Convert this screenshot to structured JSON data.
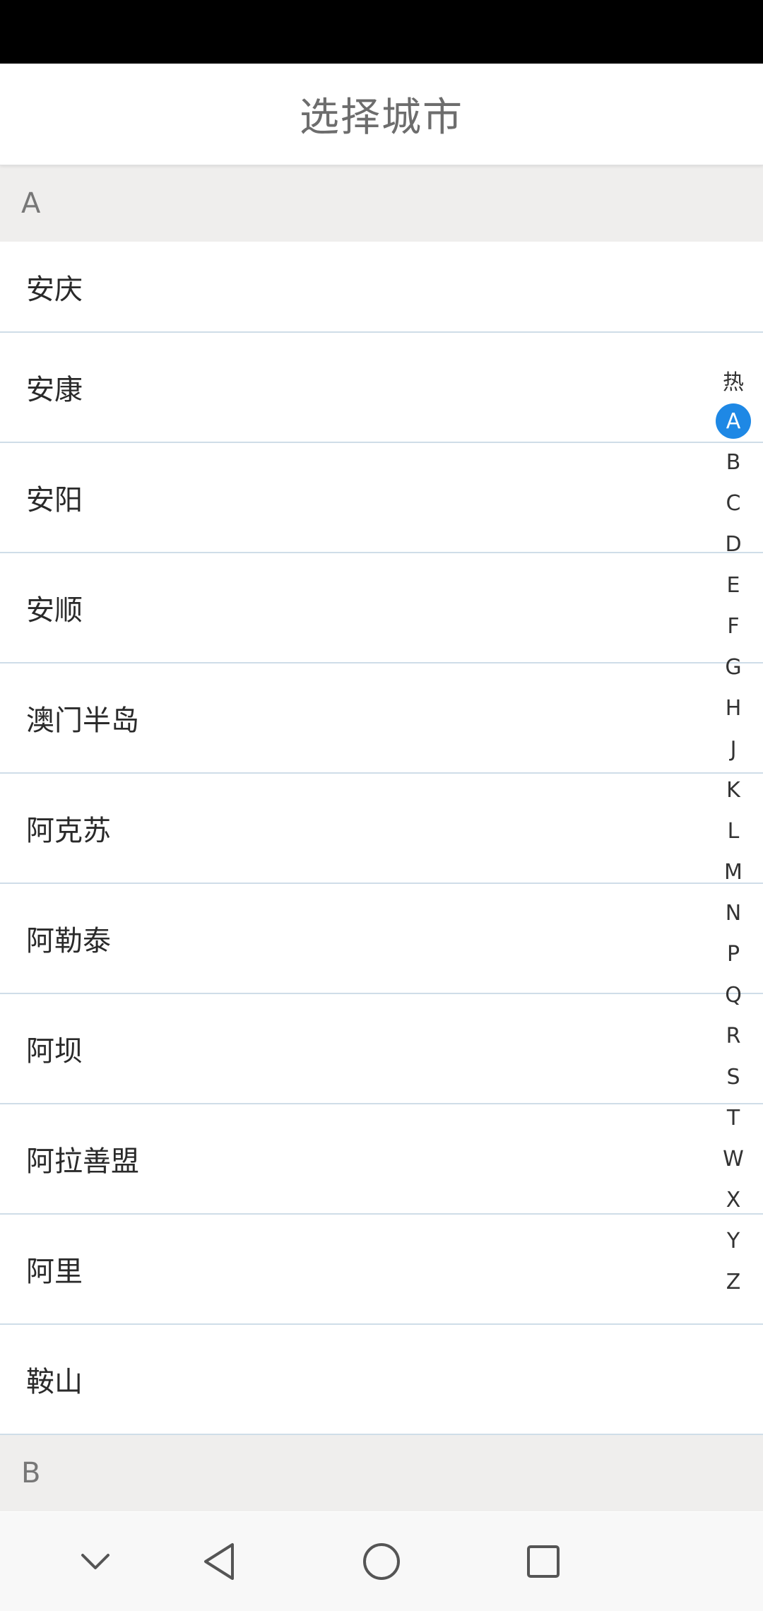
{
  "header": {
    "title": "选择城市"
  },
  "sections": [
    {
      "letter": "A",
      "cities": [
        "安庆",
        "安康",
        "安阳",
        "安顺",
        "澳门半岛",
        "阿克苏",
        "阿勒泰",
        "阿坝",
        "阿拉善盟",
        "阿里",
        "鞍山"
      ]
    },
    {
      "letter": "B",
      "cities": []
    }
  ],
  "index_bar": {
    "items": [
      "热",
      "A",
      "B",
      "C",
      "D",
      "E",
      "F",
      "G",
      "H",
      "J",
      "K",
      "L",
      "M",
      "N",
      "P",
      "Q",
      "R",
      "S",
      "T",
      "W",
      "X",
      "Y",
      "Z"
    ],
    "active": "A",
    "active_color": "#1e88e5"
  },
  "nav_bar": {
    "icons": [
      "chevron-down-icon",
      "back-icon",
      "home-icon",
      "recents-icon"
    ]
  }
}
